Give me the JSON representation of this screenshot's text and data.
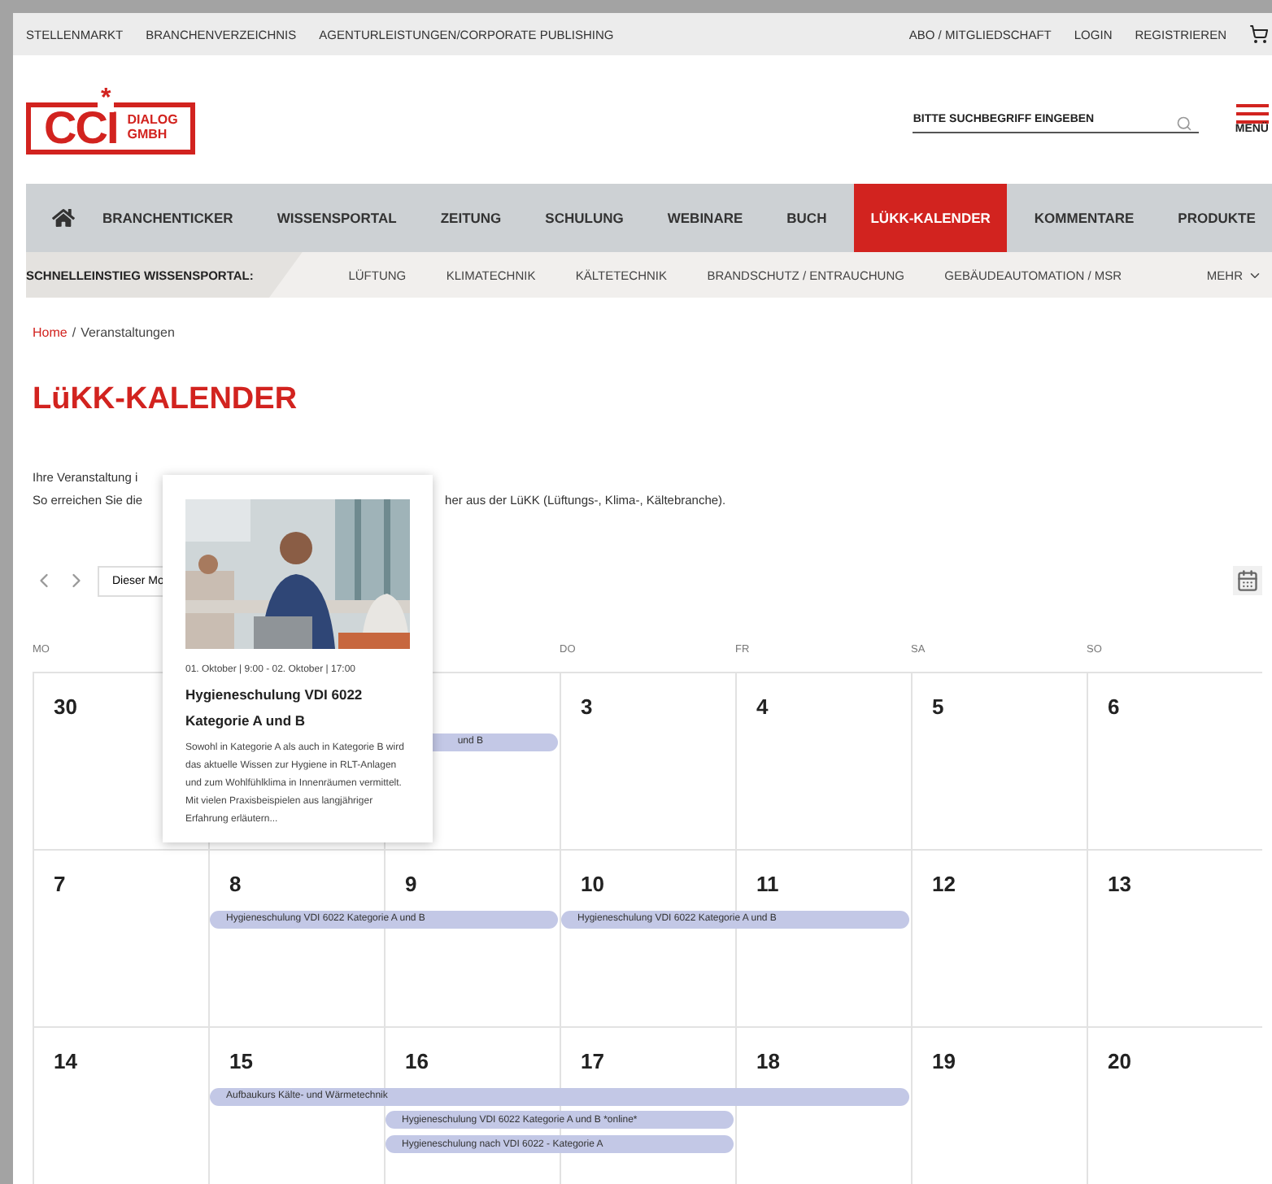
{
  "top_links": [
    "STELLENMARKT",
    "BRANCHENVERZEICHNIS",
    "AGENTURLEISTUNGEN/CORPORATE PUBLISHING"
  ],
  "account_links": [
    "ABO / MITGLIEDSCHAFT",
    "LOGIN",
    "REGISTRIEREN"
  ],
  "logo": {
    "mark": "CCI",
    "star": "*",
    "line_1": "DIALOG",
    "line_2": "GMBH"
  },
  "search": {
    "placeholder": "BITTE SUCHBEGRIFF EINGEBEN"
  },
  "menu_label": "MENÜ",
  "main_nav": [
    {
      "label": "BRANCHENTICKER",
      "selected": false
    },
    {
      "label": "WISSENSPORTAL",
      "selected": false
    },
    {
      "label": "ZEITUNG",
      "selected": false
    },
    {
      "label": "SCHULUNG",
      "selected": false
    },
    {
      "label": "WEBINARE",
      "selected": false
    },
    {
      "label": "BUCH",
      "selected": false
    },
    {
      "label": "LÜKK-KALENDER",
      "selected": true
    },
    {
      "label": "KOMMENTARE",
      "selected": false
    },
    {
      "label": "PRODUKTE",
      "selected": false
    }
  ],
  "quick_nav": {
    "label": "SCHNELLEINSTIEG WISSENSPORTAL:",
    "items": [
      "LÜFTUNG",
      "KLIMATECHNIK",
      "KÄLTETECHNIK",
      "BRANDSCHUTZ / ENTRAUCHUNG",
      "GEBÄUDEAUTOMATION / MSR"
    ],
    "more": "MEHR"
  },
  "breadcrumb": {
    "home": "Home",
    "separator": "/",
    "current": "Veranstaltungen"
  },
  "title": "LüKK-KALENDER",
  "intro": {
    "line_1": "Ihre Veranstaltung i",
    "line_2_start": "So erreichen Sie die",
    "line_2_end": "her aus der LüKK (Lüftungs-, Klima-, Kältebranche)."
  },
  "calendar": {
    "month_button": "Dieser Mo",
    "weekdays": [
      "MO",
      "DO",
      "FR",
      "SA",
      "SO"
    ],
    "weeks": [
      {
        "days": [
          "30",
          "3",
          "4",
          "5",
          "6"
        ],
        "events": [
          {
            "label": "und B",
            "kind": "tail"
          }
        ]
      },
      {
        "days": [
          "7",
          "8",
          "9",
          "10",
          "11",
          "12",
          "13"
        ],
        "events": [
          {
            "label": "Hygieneschulung VDI 6022 Kategorie A und B",
            "kind": "bar"
          },
          {
            "label": "Hygieneschulung VDI 6022 Kategorie A und B",
            "kind": "bar"
          }
        ]
      },
      {
        "days": [
          "14",
          "15",
          "16",
          "17",
          "18",
          "19",
          "20"
        ],
        "events": [
          {
            "label": "Aufbaukurs Kälte- und Wärmetechnik",
            "kind": "bar"
          },
          {
            "label": "Hygieneschulung VDI 6022 Kategorie A und B *online*",
            "kind": "bar"
          },
          {
            "label": "Hygieneschulung nach VDI 6022 - Kategorie A",
            "kind": "bar"
          }
        ]
      }
    ]
  },
  "popup": {
    "date": "01. Oktober | 9:00 - 02. Oktober | 17:00",
    "title": "Hygieneschulung VDI 6022 Kategorie A und B",
    "text": "Sowohl in Kategorie A als auch in Kategorie B wird das aktuelle Wissen zur Hygiene in RLT-Anlagen und zum Wohlfühlklima in Innenräumen vermittelt. Mit vielen Praxisbeispielen aus langjähriger Erfahrung erläutern..."
  }
}
